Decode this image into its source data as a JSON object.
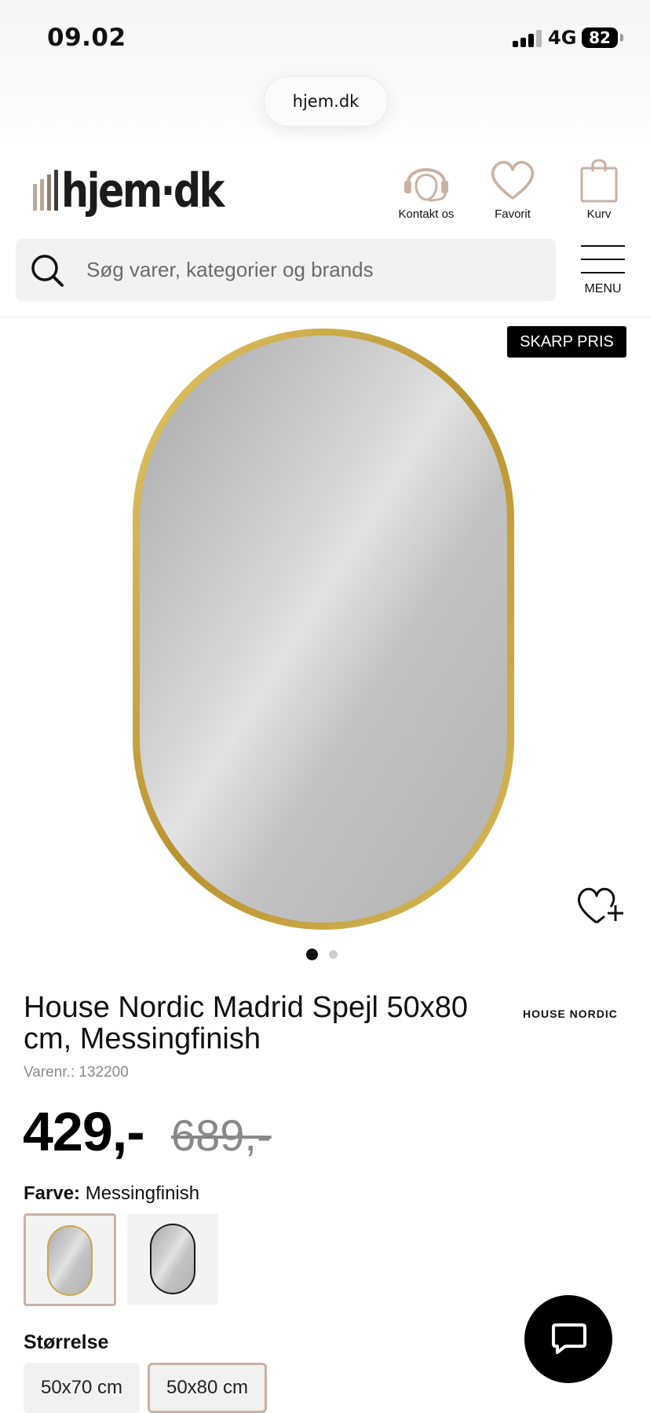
{
  "status_bar": {
    "time": "09.02",
    "network": "4G",
    "battery": "82"
  },
  "browser": {
    "url": "hjem.dk"
  },
  "header": {
    "logo_text": "hjem·dk",
    "contact_label": "Kontakt os",
    "favorite_label": "Favorit",
    "cart_label": "Kurv",
    "menu_label": "MENU"
  },
  "search": {
    "placeholder": "Søg varer, kategorier og brands",
    "value": ""
  },
  "product": {
    "badge": "SKARP PRIS",
    "title": "House Nordic Madrid Spejl 50x80 cm, Messingfinish",
    "brand": "HOUSE NORDIC",
    "sku": "Varenr.: 132200",
    "price": "429,-",
    "old_price": "689,-",
    "image_count": 2,
    "active_image": 1,
    "color_label": "Farve:",
    "color_value": "Messingfinish",
    "color_options": [
      "Messingfinish",
      "Sort"
    ],
    "size_label": "Størrelse",
    "sizes": [
      "50x70 cm",
      "50x80 cm"
    ],
    "selected_size": "50x80 cm"
  },
  "colors": {
    "frame_brass": "#c9a94a",
    "badge_bg": "#000000",
    "selected_border": "#c9b2a3",
    "logo_accent": "#b9a893"
  }
}
